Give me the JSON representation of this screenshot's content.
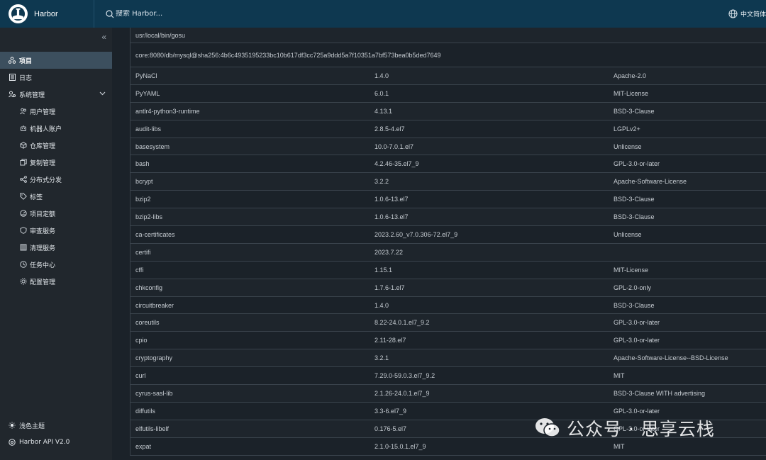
{
  "header": {
    "app_name": "Harbor",
    "search_placeholder": "搜索 Harbor...",
    "language": "中文简体"
  },
  "sidebar": {
    "items": [
      {
        "label": "项目",
        "icon": "projects-icon",
        "active": true
      },
      {
        "label": "日志",
        "icon": "logs-icon"
      },
      {
        "label": "系统管理",
        "icon": "admin-icon"
      }
    ],
    "sub_items": [
      {
        "label": "用户管理",
        "icon": "users-icon"
      },
      {
        "label": "机器人账户",
        "icon": "robot-icon"
      },
      {
        "label": "仓库管理",
        "icon": "registry-icon"
      },
      {
        "label": "复制管理",
        "icon": "replication-icon"
      },
      {
        "label": "分布式分发",
        "icon": "share-icon"
      },
      {
        "label": "标签",
        "icon": "tag-icon"
      },
      {
        "label": "项目定额",
        "icon": "quota-icon"
      },
      {
        "label": "审查服务",
        "icon": "shield-icon"
      },
      {
        "label": "清理服务",
        "icon": "cleanup-icon"
      },
      {
        "label": "任务中心",
        "icon": "clock-icon"
      },
      {
        "label": "配置管理",
        "icon": "gear-icon"
      }
    ],
    "theme_toggle": "浅色主题",
    "api_link": "Harbor API V2.0"
  },
  "table": {
    "top_rows": [
      "usr/local/bin/gosu",
      "core:8080/db/mysql@sha256:4b6c4935195233bc10b617df3cc725a9ddd5a7f10351a7bf573bea0b5ded7649"
    ],
    "rows": [
      [
        "PyNaCl",
        "1.4.0",
        "Apache-2.0"
      ],
      [
        "PyYAML",
        "6.0.1",
        "MIT-License"
      ],
      [
        "antlr4-python3-runtime",
        "4.13.1",
        "BSD-3-Clause"
      ],
      [
        "audit-libs",
        "2.8.5-4.el7",
        "LGPLv2+"
      ],
      [
        "basesystem",
        "10.0-7.0.1.el7",
        "Unlicense"
      ],
      [
        "bash",
        "4.2.46-35.el7_9",
        "GPL-3.0-or-later"
      ],
      [
        "bcrypt",
        "3.2.2",
        "Apache-Software-License"
      ],
      [
        "bzip2",
        "1.0.6-13.el7",
        "BSD-3-Clause"
      ],
      [
        "bzip2-libs",
        "1.0.6-13.el7",
        "BSD-3-Clause"
      ],
      [
        "ca-certificates",
        "2023.2.60_v7.0.306-72.el7_9",
        "Unlicense"
      ],
      [
        "certifi",
        "2023.7.22",
        ""
      ],
      [
        "cffi",
        "1.15.1",
        "MIT-License"
      ],
      [
        "chkconfig",
        "1.7.6-1.el7",
        "GPL-2.0-only"
      ],
      [
        "circuitbreaker",
        "1.4.0",
        "BSD-3-Clause"
      ],
      [
        "coreutils",
        "8.22-24.0.1.el7_9.2",
        "GPL-3.0-or-later"
      ],
      [
        "cpio",
        "2.11-28.el7",
        "GPL-3.0-or-later"
      ],
      [
        "cryptography",
        "3.2.1",
        "Apache-Software-License--BSD-License"
      ],
      [
        "curl",
        "7.29.0-59.0.3.el7_9.2",
        "MIT"
      ],
      [
        "cyrus-sasl-lib",
        "2.1.26-24.0.1.el7_9",
        "BSD-3-Clause WITH advertising"
      ],
      [
        "diffutils",
        "3.3-6.el7_9",
        "GPL-3.0-or-later"
      ],
      [
        "elfutils-libelf",
        "0.176-5.el7",
        "GPL-3.0-or-later"
      ],
      [
        "expat",
        "2.1.0-15.0.1.el7_9",
        "MIT"
      ]
    ]
  },
  "watermark": "公众号 · 思享云栈",
  "colors": {
    "header_bg": "#0e3850",
    "sidebar_bg": "#21272d",
    "main_bg": "#1b2229",
    "active_item_bg": "#3c4f5e"
  }
}
